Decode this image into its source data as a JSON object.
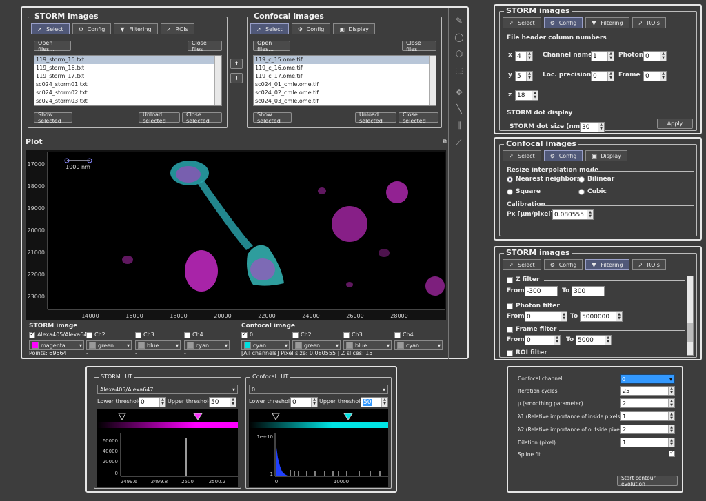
{
  "storm_panel": {
    "title": "STORM images",
    "tabs": [
      "Select",
      "Config",
      "Filtering",
      "ROIs"
    ],
    "open_btn": "Open files...",
    "close_btn": "Close files",
    "files": [
      "119_storm_15.txt",
      "119_storm_16.txt",
      "119_storm_17.txt",
      "sc024_storm01.txt",
      "sc024_storm02.txt",
      "sc024_storm03.txt"
    ],
    "show_sel": "Show selected",
    "unload_sel": "Unload selected",
    "close_sel": "Close selected"
  },
  "confocal_panel": {
    "title": "Confocal images",
    "tabs": [
      "Select",
      "Config",
      "Display"
    ],
    "open_btn": "Open files...",
    "close_btn": "Close files",
    "files": [
      "119_c_15.ome.tif",
      "119_c_16.ome.tif",
      "119_c_17.ome.tif",
      "sc024_01_cmle.ome.tif",
      "sc024_02_cmle.ome.tif",
      "sc024_03_cmle.ome.tif"
    ],
    "show_sel": "Show selected",
    "unload_sel": "Unload selected",
    "close_sel": "Close selected"
  },
  "plot": {
    "title": "Plot",
    "scalebar": "1000 nm",
    "yticks": [
      "17000",
      "18000",
      "19000",
      "20000",
      "21000",
      "22000",
      "23000"
    ],
    "xticks": [
      "14000",
      "16000",
      "18000",
      "20000",
      "22000",
      "24000",
      "26000",
      "28000"
    ]
  },
  "storm_image": {
    "title": "STORM image",
    "channels": [
      "Alexa405/Alexa647",
      "Ch2",
      "Ch3",
      "Ch4"
    ],
    "colors": [
      "magenta",
      "green",
      "blue",
      "cyan"
    ],
    "color_hex": [
      "#ff00ff",
      "#9a9a9a",
      "#9a9a9a",
      "#9a9a9a"
    ],
    "points": "Points: 69564",
    "dashes": [
      "-",
      "-",
      "-"
    ]
  },
  "confocal_image": {
    "title": "Confocal image",
    "channels": [
      "0",
      "Ch2",
      "Ch3",
      "Ch4"
    ],
    "colors": [
      "cyan",
      "green",
      "blue",
      "cyan"
    ],
    "color_hex": [
      "#00e0e0",
      "#9a9a9a",
      "#9a9a9a",
      "#9a9a9a"
    ],
    "info": "[All channels] Pixel size: 0.080555 | Z slices: 15"
  },
  "storm_config": {
    "title": "STORM images",
    "tabs": [
      "Select",
      "Config",
      "Filtering",
      "ROIs"
    ],
    "header_title": "File header column numbers",
    "x_label": "x",
    "x_val": "4",
    "y_label": "y",
    "y_val": "5",
    "z_label": "z",
    "z_val": "18",
    "channel_label": "Channel name",
    "channel_val": "1",
    "loc_label": "Loc. precision",
    "loc_val": "0",
    "photon_label": "Photon",
    "photon_val": "0",
    "frame_label": "Frame",
    "frame_val": "0",
    "dot_title": "STORM dot display",
    "dot_label": "STORM dot size (nm)",
    "dot_val": "30",
    "apply": "Apply"
  },
  "confocal_config": {
    "title": "Confocal images",
    "tabs": [
      "Select",
      "Config",
      "Display"
    ],
    "resize_title": "Resize interpolation mode",
    "opts": [
      "Nearest neighbors",
      "Bilinear",
      "Square",
      "Cubic"
    ],
    "calib_title": "Calibration",
    "px_label": "Px [µm/pixel]",
    "px_val": "0.080555"
  },
  "storm_filter": {
    "title": "STORM images",
    "tabs": [
      "Select",
      "Config",
      "Filtering",
      "ROIs"
    ],
    "z_filter": "Z filter",
    "z_from": "-300",
    "z_to": "300",
    "photon_filter": "Photon filter",
    "p_from": "0",
    "p_to": "5000000",
    "frame_filter": "Frame filter",
    "f_from": "0",
    "f_to": "5000",
    "roi_filter": "ROI filter",
    "from": "From",
    "to": "To"
  },
  "storm_lut": {
    "title": "STORM LUT",
    "combo": "Alexa405/Alexa647",
    "lower_label": "Lower threshold",
    "lower": "0",
    "upper_label": "Upper threshold",
    "upper": "50",
    "yticks": [
      "60000",
      "40000",
      "20000",
      "0"
    ],
    "xticks": [
      "2499.6",
      "2499.8",
      "2500",
      "2500.2"
    ]
  },
  "confocal_lut": {
    "title": "Confocal LUT",
    "combo": "0",
    "lower_label": "Lower threshold",
    "lower": "0",
    "upper_label": "Upper threshold",
    "upper": "50",
    "yticks": [
      "1e+10",
      "1"
    ],
    "xticks": [
      "0",
      "10000"
    ]
  },
  "contour": {
    "rows": [
      {
        "label": "Confocal channel",
        "value": "0"
      },
      {
        "label": "Iteration cycles",
        "value": "25"
      },
      {
        "label": "µ (smoothing parameter)",
        "value": "2"
      },
      {
        "label": "λ1 (Relative importance of inside pixels)",
        "value": "1"
      },
      {
        "label": "λ2 (Relative importance of outside pixels)",
        "value": "2"
      },
      {
        "label": "Dilation (pixel)",
        "value": "1"
      },
      {
        "label": "Spline fit",
        "value": ""
      }
    ],
    "start_btn": "Start contour evolution",
    "accent": "#3399ff"
  }
}
